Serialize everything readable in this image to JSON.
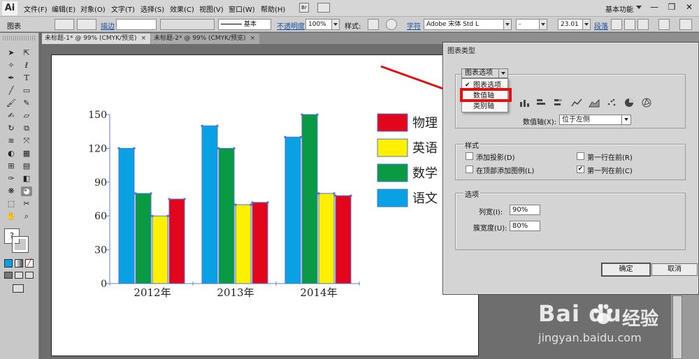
{
  "app": {
    "logo": "Ai"
  },
  "menubar": {
    "items": [
      "文件(F)",
      "编辑(E)",
      "对象(O)",
      "文字(T)",
      "选择(S)",
      "效果(C)",
      "视图(V)",
      "窗口(W)",
      "帮助(H)"
    ],
    "bridge_label": "Br",
    "workspace": "基本功能",
    "win_minimize": "—",
    "win_restore": "❐",
    "win_close": "✕"
  },
  "controlbar": {
    "selection": "图表",
    "stroke_link": "描边",
    "stroke_profile": "基本",
    "opacity_link": "不透明度",
    "opacity_value": "100%",
    "style_label": "样式:",
    "font_link": "字符",
    "font_name": "Adobe 宋体 Std L",
    "font_style": "-",
    "font_size": "23.01",
    "para_link": "段落"
  },
  "tabs": [
    {
      "label": "未标题-1* @ 99% (CMYK/预览)",
      "close": "×"
    },
    {
      "label": "未标题-2* @ 99% (CMYK/预览)",
      "close": "×"
    }
  ],
  "tools": {
    "icons": [
      "selection-tool-icon",
      "direct-selection-tool-icon",
      "magic-wand-tool-icon",
      "lasso-tool-icon",
      "pen-tool-icon",
      "type-tool-icon",
      "line-tool-icon",
      "rectangle-tool-icon",
      "paintbrush-tool-icon",
      "pencil-tool-icon",
      "blob-brush-tool-icon",
      "eraser-tool-icon",
      "rotate-tool-icon",
      "scale-tool-icon",
      "width-tool-icon",
      "free-transform-tool-icon",
      "shape-builder-tool-icon",
      "perspective-grid-tool-icon",
      "mesh-tool-icon",
      "gradient-tool-icon",
      "eyedropper-tool-icon",
      "blend-tool-icon",
      "symbol-sprayer-tool-icon",
      "graph-tool-icon",
      "artboard-tool-icon",
      "slice-tool-icon",
      "hand-tool-icon",
      "zoom-tool-icon"
    ],
    "fill_stroke_label": "?"
  },
  "chart_data": {
    "type": "bar",
    "categories": [
      "2012年",
      "2013年",
      "2014年"
    ],
    "series": [
      {
        "name": "语文",
        "color": "#0aa0e4",
        "values": [
          120,
          140,
          130
        ]
      },
      {
        "name": "数学",
        "color": "#0a9a44",
        "values": [
          80,
          120,
          150
        ]
      },
      {
        "name": "英语",
        "color": "#fef000",
        "values": [
          60,
          70,
          80
        ]
      },
      {
        "name": "物理",
        "color": "#e2051b",
        "values": [
          75,
          72,
          78
        ]
      }
    ],
    "legend_order": [
      "物理",
      "英语",
      "数学",
      "语文"
    ],
    "ylim": [
      0,
      150
    ],
    "yticks": [
      "0",
      "30",
      "60",
      "90",
      "120",
      "150"
    ],
    "legend_placement": "right"
  },
  "dialog": {
    "title": "图表类型",
    "panel_select": "图表选项",
    "panel_menu": [
      {
        "label": "图表选项",
        "checked": true
      },
      {
        "label": "数值轴",
        "checked": false
      },
      {
        "label": "类别轴",
        "checked": false
      }
    ],
    "value_axis_label": "数值轴(X):",
    "value_axis_value": "位于左侧",
    "style_group": "样式",
    "style_options": [
      {
        "label": "添加投影(D)",
        "checked": false
      },
      {
        "label": "第一行在前(R)",
        "checked": false
      },
      {
        "label": "在顶部添加图例(L)",
        "checked": false
      },
      {
        "label": "第一列在前(C)",
        "checked": true
      }
    ],
    "options_group": "选项",
    "column_width_label": "列宽(I):",
    "column_width_value": "90%",
    "cluster_width_label": "簇宽度(U):",
    "cluster_width_value": "80%",
    "ok": "确定",
    "cancel": "取消",
    "checkmark": "✔"
  },
  "watermark": {
    "brand": "Bai du",
    "sub": "jingyan.baidu.com",
    "paw_label": "经验"
  },
  "annotation_color": "#e01010"
}
